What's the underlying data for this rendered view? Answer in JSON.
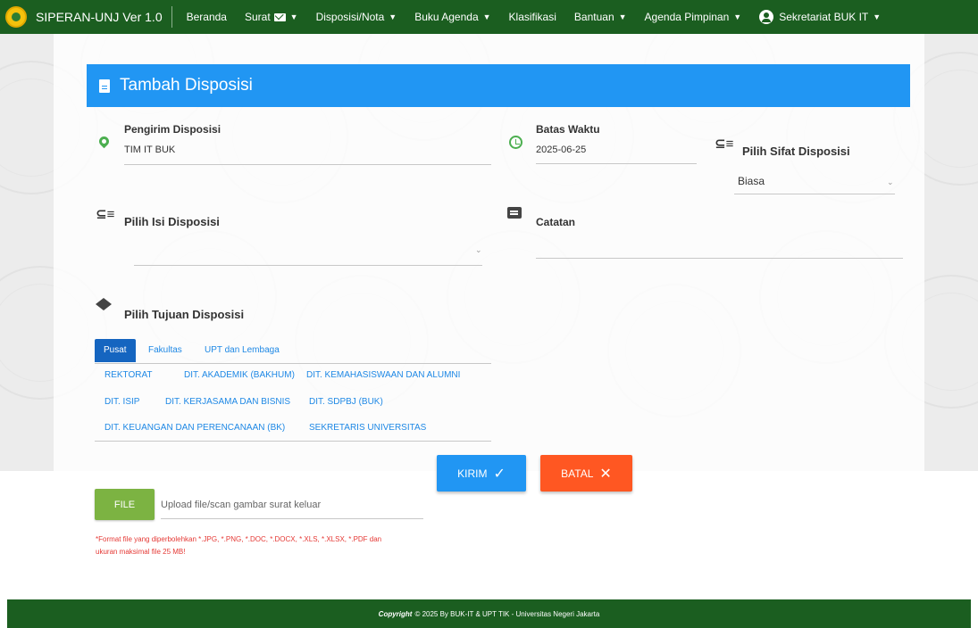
{
  "navbar": {
    "brand": "SIPERAN-UNJ Ver 1.0",
    "items": [
      {
        "label": "Beranda"
      },
      {
        "label": "Surat"
      },
      {
        "label": "Disposisi/Nota"
      },
      {
        "label": "Buku Agenda"
      },
      {
        "label": "Klasifikasi"
      },
      {
        "label": "Bantuan"
      },
      {
        "label": "Agenda Pimpinan"
      }
    ],
    "user": "Sekretariat BUK IT"
  },
  "card": {
    "title": "Tambah Disposisi"
  },
  "form": {
    "pengirim": {
      "label": "Pengirim Disposisi",
      "value": "TIM IT BUK"
    },
    "batas_waktu": {
      "label": "Batas Waktu",
      "value": "2025-06-25"
    },
    "sifat": {
      "label": "Pilih Sifat Disposisi",
      "value": "Biasa"
    },
    "isi": {
      "label": "Pilih Isi Disposisi",
      "value": ""
    },
    "catatan": {
      "label": "Catatan",
      "value": ""
    },
    "tujuan": {
      "label": "Pilih Tujuan Disposisi",
      "tabs": [
        {
          "label": "Pusat",
          "active": true
        },
        {
          "label": "Fakultas",
          "active": false
        },
        {
          "label": "UPT dan Lembaga",
          "active": false
        }
      ],
      "units": [
        "REKTORAT",
        "DIT. AKADEMIK (BAKHUM)",
        "DIT. KEMAHASISWAAN DAN ALUMNI",
        "DIT. ISIP",
        "DIT. KERJASAMA DAN BISNIS",
        "DIT. SDPBJ (BUK)",
        "DIT. KEUANGAN DAN PERENCANAAN (BK)",
        "SEKRETARIS UNIVERSITAS"
      ]
    }
  },
  "actions": {
    "kirim": "KIRIM",
    "batal": "BATAL"
  },
  "upload": {
    "button": "FILE",
    "placeholder": "Upload file/scan gambar surat keluar",
    "note_line1": "*Format file yang diperbolehkan *.JPG, *.PNG, *.DOC, *.DOCX, *.XLS, *.XLSX, *.PDF dan",
    "note_line2": "ukuran maksimal file 25 MB!"
  },
  "footer": {
    "copyright": "Copyright",
    "text": "© 2025 By BUK-IT & UPT TIK - Universitas Negeri Jakarta"
  },
  "colors": {
    "navbar": "#1b5e20",
    "header": "#2196f3",
    "kirim": "#2196f3",
    "batal": "#ff5722",
    "file": "#7cb342",
    "icon_green": "#4caf50",
    "link": "#1e88e5"
  }
}
